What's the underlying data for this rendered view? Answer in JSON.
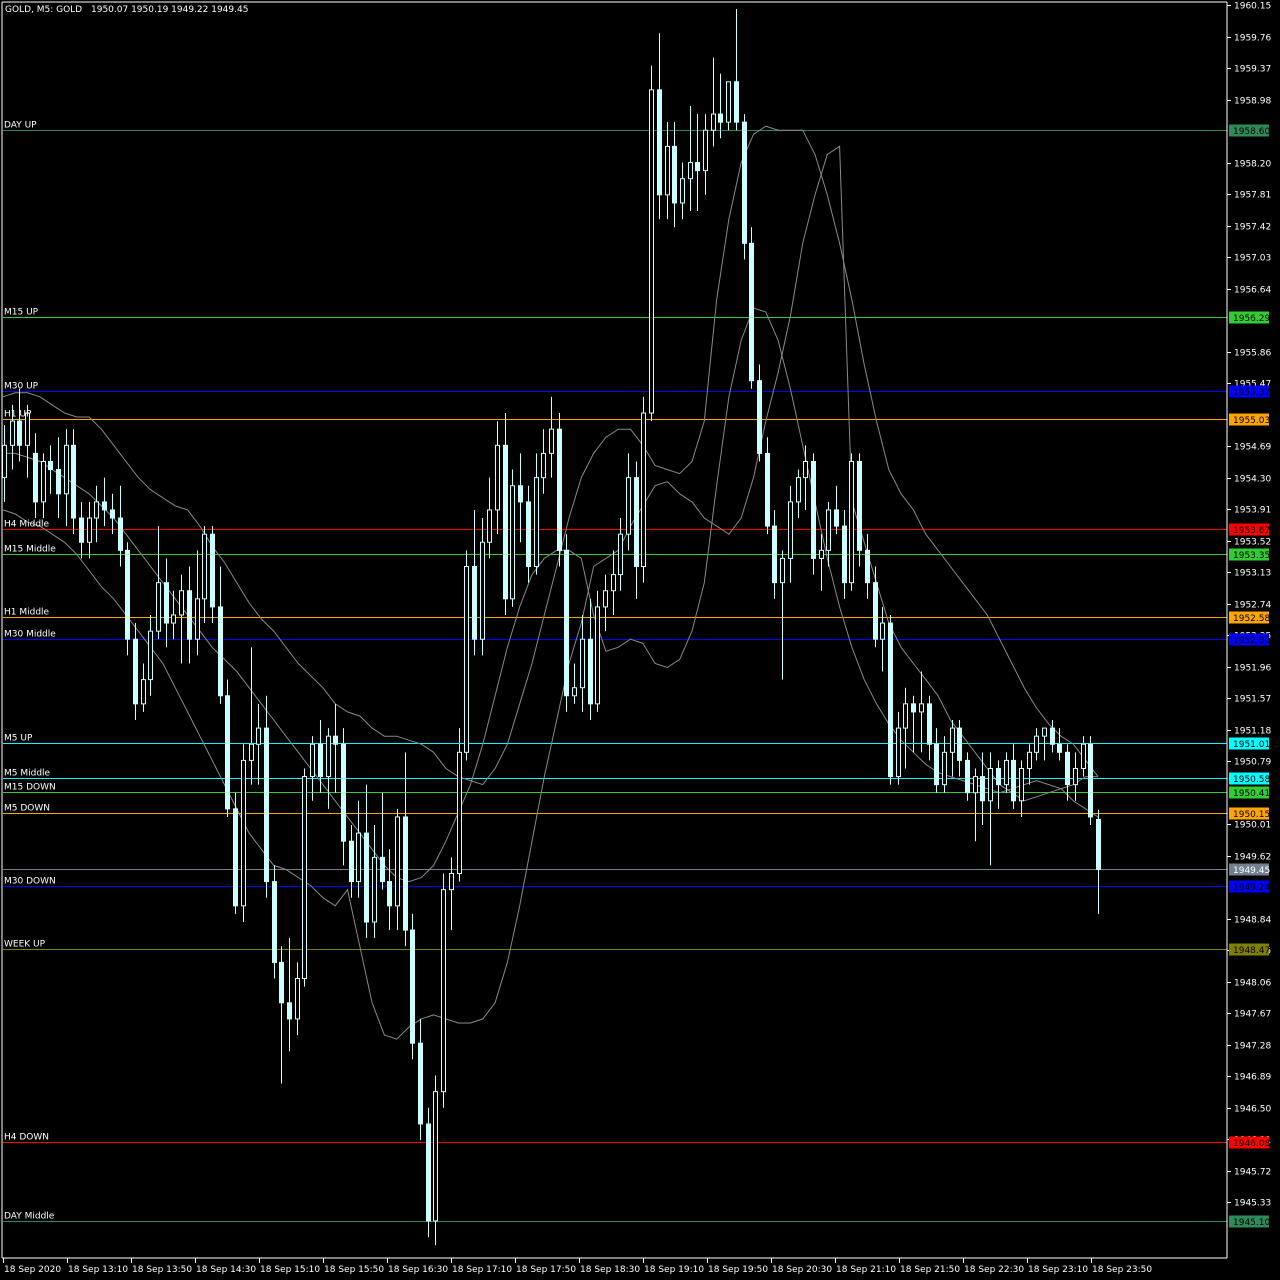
{
  "header": {
    "title": "GOLD, M5:  GOLD",
    "ohlc": "1950.07 1950.19 1949.22 1949.45"
  },
  "colors": {
    "background": "#000000",
    "candle": "#ccffff",
    "band": "#8a8a8a",
    "axis": "#ffffff"
  },
  "chart_data": {
    "type": "candlestick",
    "symbol": "GOLD",
    "timeframe": "M5",
    "ylim": [
      1944.74,
      1960.15
    ],
    "y_ticks": [
      1960.15,
      1959.76,
      1959.37,
      1958.98,
      1958.2,
      1957.81,
      1957.42,
      1957.03,
      1956.64,
      1955.86,
      1955.47,
      1954.69,
      1954.3,
      1953.91,
      1953.52,
      1953.13,
      1952.74,
      1952.35,
      1951.96,
      1951.57,
      1951.18,
      1950.79,
      1950.01,
      1949.62,
      1948.84,
      1948.45,
      1948.06,
      1947.67,
      1947.28,
      1946.89,
      1946.5,
      1946.11,
      1945.72,
      1945.33
    ],
    "y_tick_labels": [
      "1960.15",
      "1959.76",
      "1959.37",
      "1958.98",
      "1958.20",
      "1957.81",
      "1957.42",
      "1957.03",
      "1956.64",
      "1955.86",
      "1955.47",
      "1954.69",
      "1954.30",
      "1953.91",
      "1953.52",
      "1953.13",
      "1952.74",
      "1952.35",
      "1951.96",
      "1951.57",
      "1951.18",
      "1950.79",
      "1950.01",
      "1949.62",
      "1948.84",
      "1948.45",
      "1948.06",
      "1947.67",
      "1947.28",
      "1946.89",
      "1946.50",
      "1946.11",
      "1945.72",
      "1945.33"
    ],
    "x_labels": [
      "18 Sep 2020",
      "18 Sep 13:10",
      "18 Sep 13:50",
      "18 Sep 14:30",
      "18 Sep 15:10",
      "18 Sep 15:50",
      "18 Sep 16:30",
      "18 Sep 17:10",
      "18 Sep 17:50",
      "18 Sep 18:30",
      "18 Sep 19:10",
      "18 Sep 19:50",
      "18 Sep 20:30",
      "18 Sep 21:10",
      "18 Sep 21:50",
      "18 Sep 22:30",
      "18 Sep 23:10",
      "18 Sep 23:50"
    ],
    "levels": [
      {
        "name": "DAY UP",
        "value": 1958.6,
        "label": "1958.60",
        "color": "#2e8b57"
      },
      {
        "name": "M15 UP",
        "value": 1956.29,
        "label": "1956.29",
        "color": "#32cd32"
      },
      {
        "name": "M30 UP",
        "value": 1955.37,
        "label": "1955.37",
        "color": "#0000ff"
      },
      {
        "name": "H1 UP",
        "value": 1955.03,
        "label": "1955.03",
        "color": "#ffa500"
      },
      {
        "name": "H4 Middle",
        "value": 1953.67,
        "label": "1953.67",
        "color": "#ff0000"
      },
      {
        "name": "M15 Middle",
        "value": 1953.35,
        "label": "1953.35",
        "color": "#32cd32"
      },
      {
        "name": "H1 Middle",
        "value": 1952.58,
        "label": "1952.58",
        "color": "#ffa500"
      },
      {
        "name": "M30 Middle",
        "value": 1952.3,
        "label": "1952.30",
        "color": "#0000ff"
      },
      {
        "name": "M5 UP",
        "value": 1951.01,
        "label": "1951.01",
        "color": "#00ffff"
      },
      {
        "name": "M5 Middle",
        "value": 1950.58,
        "label": "1950.58",
        "color": "#00ffff"
      },
      {
        "name": "M15 DOWN",
        "value": 1950.41,
        "label": "1950.41",
        "color": "#32cd32"
      },
      {
        "name": "M5 DOWN",
        "value": 1950.15,
        "label": "1950.15",
        "color": "#ffa500"
      },
      {
        "name": "M30 DOWN",
        "value": 1949.24,
        "label": "1949.24",
        "color": "#0000ff"
      },
      {
        "name": "WEEK UP",
        "value": 1948.47,
        "label": "1948.47",
        "color": "#808000"
      },
      {
        "name": "H4 DOWN",
        "value": 1946.08,
        "label": "1946.08",
        "color": "#ff0000"
      },
      {
        "name": "DAY Middle",
        "value": 1945.1,
        "label": "1945.10",
        "color": "#2e8b57"
      }
    ],
    "last_price": {
      "value": 1949.45,
      "label": "1949.45",
      "color": "#708090"
    },
    "candles": [
      [
        1954.3,
        1954.95,
        1954.0,
        1954.7
      ],
      [
        1954.7,
        1955.2,
        1954.4,
        1955.0
      ],
      [
        1955.0,
        1955.4,
        1954.5,
        1954.7
      ],
      [
        1954.7,
        1955.2,
        1954.3,
        1955.1
      ],
      [
        1954.6,
        1954.85,
        1953.8,
        1954.0
      ],
      [
        1954.0,
        1954.6,
        1953.8,
        1954.5
      ],
      [
        1954.5,
        1954.7,
        1954.1,
        1954.4
      ],
      [
        1954.4,
        1954.8,
        1953.8,
        1954.1
      ],
      [
        1954.1,
        1954.9,
        1953.7,
        1954.7
      ],
      [
        1954.7,
        1954.9,
        1953.6,
        1953.8
      ],
      [
        1953.8,
        1954.0,
        1953.3,
        1953.5
      ],
      [
        1953.5,
        1954.0,
        1953.3,
        1953.8
      ],
      [
        1953.8,
        1954.2,
        1953.5,
        1954.0
      ],
      [
        1954.0,
        1954.3,
        1953.7,
        1953.9
      ],
      [
        1953.9,
        1954.1,
        1953.6,
        1953.8
      ],
      [
        1953.8,
        1954.2,
        1953.2,
        1953.4
      ],
      [
        1953.4,
        1953.5,
        1952.1,
        1952.3
      ],
      [
        1952.3,
        1952.5,
        1951.3,
        1951.5
      ],
      [
        1951.5,
        1952.0,
        1951.4,
        1951.8
      ],
      [
        1951.8,
        1952.6,
        1951.6,
        1952.4
      ],
      [
        1952.4,
        1953.7,
        1952.3,
        1953.0
      ],
      [
        1953.0,
        1953.3,
        1952.2,
        1952.5
      ],
      [
        1952.5,
        1952.9,
        1952.3,
        1952.6
      ],
      [
        1952.6,
        1953.1,
        1952.0,
        1952.9
      ],
      [
        1952.9,
        1953.2,
        1952.0,
        1952.3
      ],
      [
        1952.3,
        1953.4,
        1952.1,
        1952.8
      ],
      [
        1952.8,
        1953.7,
        1952.5,
        1953.6
      ],
      [
        1953.6,
        1953.7,
        1952.5,
        1952.7
      ],
      [
        1952.7,
        1953.2,
        1951.5,
        1951.6
      ],
      [
        1951.6,
        1951.8,
        1950.1,
        1950.2
      ],
      [
        1950.2,
        1950.4,
        1948.9,
        1949.0
      ],
      [
        1949.0,
        1951.0,
        1948.8,
        1950.8
      ],
      [
        1950.8,
        1952.2,
        1950.5,
        1951.0
      ],
      [
        1951.0,
        1951.5,
        1950.5,
        1951.2
      ],
      [
        1951.2,
        1951.6,
        1949.1,
        1949.3
      ],
      [
        1949.3,
        1949.5,
        1948.1,
        1948.3
      ],
      [
        1948.3,
        1948.5,
        1946.8,
        1947.8
      ],
      [
        1947.8,
        1948.6,
        1947.2,
        1947.6
      ],
      [
        1947.6,
        1948.3,
        1947.4,
        1948.1
      ],
      [
        1948.1,
        1950.7,
        1948.0,
        1950.6
      ],
      [
        1950.6,
        1951.1,
        1950.3,
        1951.0
      ],
      [
        1951.0,
        1951.3,
        1950.4,
        1950.6
      ],
      [
        1950.6,
        1951.2,
        1950.2,
        1951.1
      ],
      [
        1951.1,
        1951.5,
        1950.4,
        1951.0
      ],
      [
        1951.0,
        1951.2,
        1949.5,
        1949.8
      ],
      [
        1949.8,
        1950.0,
        1949.1,
        1949.3
      ],
      [
        1949.3,
        1950.3,
        1949.1,
        1949.9
      ],
      [
        1949.9,
        1950.5,
        1948.6,
        1948.8
      ],
      [
        1948.8,
        1950.0,
        1948.6,
        1949.6
      ],
      [
        1949.6,
        1950.4,
        1949.2,
        1949.3
      ],
      [
        1949.3,
        1949.7,
        1948.7,
        1949.0
      ],
      [
        1949.0,
        1950.2,
        1948.7,
        1950.1
      ],
      [
        1950.1,
        1950.9,
        1948.5,
        1948.7
      ],
      [
        1948.7,
        1948.9,
        1947.1,
        1947.3
      ],
      [
        1947.3,
        1947.6,
        1946.1,
        1946.3
      ],
      [
        1946.3,
        1946.5,
        1944.9,
        1945.1
      ],
      [
        1945.1,
        1946.9,
        1944.8,
        1946.7
      ],
      [
        1946.7,
        1949.4,
        1946.5,
        1949.2
      ],
      [
        1949.2,
        1949.6,
        1948.7,
        1949.4
      ],
      [
        1949.4,
        1951.2,
        1949.3,
        1950.9
      ],
      [
        1950.9,
        1953.4,
        1950.8,
        1953.2
      ],
      [
        1953.2,
        1953.9,
        1952.1,
        1952.3
      ],
      [
        1952.3,
        1953.8,
        1952.1,
        1953.5
      ],
      [
        1953.5,
        1954.3,
        1953.3,
        1953.9
      ],
      [
        1953.9,
        1955.0,
        1953.6,
        1954.7
      ],
      [
        1954.7,
        1955.1,
        1952.6,
        1952.8
      ],
      [
        1952.8,
        1954.4,
        1952.7,
        1954.2
      ],
      [
        1954.2,
        1954.6,
        1953.5,
        1954.0
      ],
      [
        1954.0,
        1954.2,
        1953.0,
        1953.2
      ],
      [
        1953.2,
        1954.6,
        1953.1,
        1954.3
      ],
      [
        1954.3,
        1954.9,
        1954.1,
        1954.6
      ],
      [
        1954.6,
        1955.3,
        1954.3,
        1954.9
      ],
      [
        1954.9,
        1955.1,
        1953.2,
        1953.4
      ],
      [
        1953.4,
        1953.6,
        1951.4,
        1951.6
      ],
      [
        1951.6,
        1952.0,
        1951.5,
        1951.7
      ],
      [
        1951.7,
        1952.6,
        1951.4,
        1952.3
      ],
      [
        1952.3,
        1952.8,
        1951.3,
        1951.5
      ],
      [
        1951.5,
        1952.9,
        1951.4,
        1952.7
      ],
      [
        1952.7,
        1953.1,
        1952.4,
        1952.9
      ],
      [
        1952.9,
        1953.4,
        1952.6,
        1953.1
      ],
      [
        1953.1,
        1953.8,
        1952.9,
        1953.6
      ],
      [
        1953.6,
        1954.6,
        1953.4,
        1954.3
      ],
      [
        1954.3,
        1954.5,
        1952.8,
        1953.2
      ],
      [
        1953.2,
        1955.3,
        1953.0,
        1955.1
      ],
      [
        1955.1,
        1959.4,
        1955.0,
        1959.1
      ],
      [
        1959.1,
        1959.8,
        1957.5,
        1957.8
      ],
      [
        1957.8,
        1958.7,
        1957.5,
        1958.4
      ],
      [
        1958.4,
        1958.7,
        1957.4,
        1957.7
      ],
      [
        1957.7,
        1958.2,
        1957.5,
        1958.0
      ],
      [
        1958.0,
        1958.9,
        1957.6,
        1958.2
      ],
      [
        1958.2,
        1958.8,
        1957.6,
        1958.1
      ],
      [
        1958.1,
        1958.8,
        1957.8,
        1958.6
      ],
      [
        1958.6,
        1959.5,
        1958.4,
        1958.8
      ],
      [
        1958.8,
        1959.3,
        1958.5,
        1958.7
      ],
      [
        1958.7,
        1959.1,
        1958.6,
        1959.2
      ],
      [
        1959.2,
        1960.1,
        1958.6,
        1958.7
      ],
      [
        1958.7,
        1958.8,
        1957.0,
        1957.2
      ],
      [
        1957.2,
        1957.4,
        1955.4,
        1955.5
      ],
      [
        1955.5,
        1955.7,
        1954.5,
        1954.6
      ],
      [
        1954.6,
        1954.8,
        1953.6,
        1953.7
      ],
      [
        1953.7,
        1953.9,
        1952.8,
        1953.0
      ],
      [
        1953.0,
        1953.4,
        1951.8,
        1953.3
      ],
      [
        1953.3,
        1954.2,
        1953.0,
        1954.0
      ],
      [
        1954.0,
        1954.4,
        1953.8,
        1954.3
      ],
      [
        1954.3,
        1954.7,
        1953.9,
        1954.5
      ],
      [
        1954.5,
        1954.6,
        1953.1,
        1953.3
      ],
      [
        1953.3,
        1953.6,
        1952.9,
        1953.4
      ],
      [
        1953.4,
        1954.0,
        1953.2,
        1953.9
      ],
      [
        1953.9,
        1954.2,
        1953.6,
        1953.7
      ],
      [
        1953.7,
        1953.9,
        1952.8,
        1953.0
      ],
      [
        1953.0,
        1954.6,
        1952.9,
        1954.5
      ],
      [
        1954.5,
        1954.6,
        1953.2,
        1953.4
      ],
      [
        1953.4,
        1953.6,
        1952.8,
        1953.0
      ],
      [
        1953.0,
        1953.2,
        1952.2,
        1952.3
      ],
      [
        1952.3,
        1952.7,
        1951.9,
        1952.5
      ],
      [
        1952.5,
        1952.6,
        1950.5,
        1950.6
      ],
      [
        1950.6,
        1951.4,
        1950.5,
        1951.2
      ],
      [
        1951.2,
        1951.7,
        1950.7,
        1951.5
      ],
      [
        1951.5,
        1951.6,
        1950.9,
        1951.4
      ],
      [
        1951.4,
        1951.9,
        1950.9,
        1951.5
      ],
      [
        1951.5,
        1951.6,
        1950.8,
        1951.0
      ],
      [
        1951.0,
        1951.2,
        1950.4,
        1950.5
      ],
      [
        1950.5,
        1951.1,
        1950.4,
        1950.9
      ],
      [
        1950.9,
        1951.3,
        1950.6,
        1951.2
      ],
      [
        1951.2,
        1951.3,
        1950.6,
        1950.8
      ],
      [
        1950.8,
        1950.9,
        1950.3,
        1950.4
      ],
      [
        1950.4,
        1950.7,
        1949.8,
        1950.6
      ],
      [
        1950.6,
        1950.9,
        1950.0,
        1950.3
      ],
      [
        1950.3,
        1950.9,
        1949.5,
        1950.7
      ],
      [
        1950.7,
        1950.8,
        1950.2,
        1950.5
      ],
      [
        1950.5,
        1950.9,
        1950.4,
        1950.8
      ],
      [
        1950.8,
        1951.0,
        1950.2,
        1950.3
      ],
      [
        1950.3,
        1950.8,
        1950.1,
        1950.7
      ],
      [
        1950.7,
        1951.0,
        1950.5,
        1950.9
      ],
      [
        1950.9,
        1951.2,
        1950.8,
        1951.1
      ],
      [
        1951.1,
        1951.2,
        1950.8,
        1951.2
      ],
      [
        1951.2,
        1951.3,
        1950.9,
        1951.0
      ],
      [
        1951.0,
        1951.2,
        1950.8,
        1950.9
      ],
      [
        1950.9,
        1951.0,
        1950.3,
        1950.5
      ],
      [
        1950.5,
        1950.9,
        1950.3,
        1950.7
      ],
      [
        1950.7,
        1951.1,
        1950.6,
        1951.0
      ],
      [
        1951.0,
        1951.1,
        1950.0,
        1950.1
      ],
      [
        1950.07,
        1950.19,
        1948.9,
        1949.45
      ]
    ],
    "bands": {
      "upper": [
        1955.3,
        1955.35,
        1955.35,
        1955.3,
        1955.2,
        1955.1,
        1955.05,
        1955.05,
        1954.9,
        1954.7,
        1954.5,
        1954.3,
        1954.15,
        1954.05,
        1953.95,
        1953.9,
        1953.7,
        1953.45,
        1953.25,
        1953.0,
        1952.75,
        1952.55,
        1952.4,
        1952.2,
        1952.0,
        1951.85,
        1951.7,
        1951.5,
        1951.4,
        1951.35,
        1951.2,
        1951.1,
        1951.1,
        1951.05,
        1951.0,
        1950.9,
        1950.7,
        1950.6,
        1950.55,
        1950.5,
        1950.7,
        1951.0,
        1951.5,
        1952.0,
        1952.6,
        1953.2,
        1953.8,
        1954.3,
        1954.6,
        1954.8,
        1954.9,
        1954.9,
        1954.7,
        1954.45,
        1954.4,
        1954.35,
        1954.5,
        1955.0,
        1956.5,
        1957.5,
        1958.2,
        1958.55,
        1958.65,
        1958.6,
        1958.6,
        1958.6,
        1958.3,
        1957.8,
        1957.2,
        1956.5,
        1955.7,
        1955.0,
        1954.4,
        1954.1,
        1953.9,
        1953.6,
        1953.4,
        1953.2,
        1953.0,
        1952.8,
        1952.6,
        1952.3,
        1952.0,
        1951.7,
        1951.45,
        1951.25,
        1951.1,
        1951.0,
        1950.8,
        1950.6
      ],
      "middle": [
        1954.6,
        1954.6,
        1954.55,
        1954.5,
        1954.4,
        1954.3,
        1954.2,
        1954.1,
        1953.95,
        1953.8,
        1953.6,
        1953.4,
        1953.2,
        1953.0,
        1952.8,
        1952.6,
        1952.4,
        1952.2,
        1952.05,
        1951.9,
        1951.7,
        1951.5,
        1951.3,
        1951.1,
        1950.9,
        1950.7,
        1950.5,
        1950.3,
        1950.1,
        1949.9,
        1949.7,
        1949.5,
        1949.35,
        1949.3,
        1949.35,
        1949.5,
        1949.8,
        1950.15,
        1950.5,
        1951.0,
        1951.6,
        1952.2,
        1952.7,
        1953.1,
        1953.3,
        1953.4,
        1953.4,
        1953.3,
        1952.6,
        1952.15,
        1952.2,
        1952.3,
        1952.25,
        1952.0,
        1951.95,
        1952.05,
        1952.4,
        1953.0,
        1954.2,
        1955.3,
        1956.0,
        1956.4,
        1956.35,
        1956.0,
        1955.4,
        1954.7,
        1954.0,
        1953.3,
        1952.7,
        1952.2,
        1951.8,
        1951.5,
        1951.25,
        1951.05,
        1950.9,
        1950.75,
        1950.65,
        1950.6,
        1950.55,
        1950.5,
        1950.45,
        1950.4,
        1950.45,
        1950.5,
        1950.55,
        1950.5,
        1950.45,
        1950.5,
        1950.6,
        1950.6
      ],
      "lower": [
        1953.9,
        1953.85,
        1953.75,
        1953.7,
        1953.6,
        1953.5,
        1953.35,
        1953.15,
        1952.95,
        1952.8,
        1952.6,
        1952.4,
        1952.2,
        1952.0,
        1951.7,
        1951.4,
        1951.1,
        1950.8,
        1950.5,
        1950.2,
        1949.9,
        1949.7,
        1949.5,
        1949.45,
        1949.35,
        1949.25,
        1949.1,
        1949.0,
        1949.2,
        1948.5,
        1947.8,
        1947.4,
        1947.35,
        1947.5,
        1947.6,
        1947.65,
        1947.6,
        1947.55,
        1947.55,
        1947.6,
        1947.8,
        1948.3,
        1949.0,
        1949.8,
        1950.6,
        1951.3,
        1952.0,
        1952.5,
        1953.2,
        1953.3,
        1953.4,
        1953.7,
        1953.95,
        1954.2,
        1954.25,
        1954.1,
        1954.0,
        1953.8,
        1953.7,
        1953.6,
        1953.8,
        1954.3,
        1955.0,
        1955.6,
        1956.3,
        1957.2,
        1957.8,
        1958.3,
        1958.4,
        1954.0,
        1953.5,
        1953.0,
        1952.5,
        1952.2,
        1952.0,
        1951.8,
        1951.6,
        1951.3,
        1951.1,
        1950.9,
        1950.7,
        1950.5,
        1950.4,
        1950.3,
        1950.35,
        1950.4,
        1950.45,
        1950.3,
        1950.2,
        1950.1
      ]
    }
  }
}
